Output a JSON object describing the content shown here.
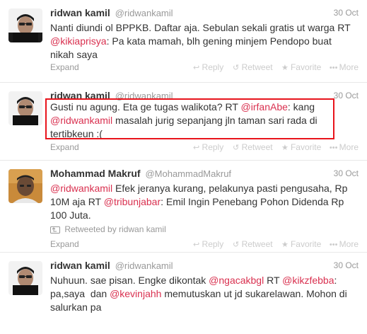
{
  "tweets": [
    {
      "fullname": "ridwan kamil",
      "username": "@ridwankamil",
      "time": "30 Oct",
      "lines": [
        [
          {
            "t": "Nanti diundi ol BPPKB. Daftar aja. Sebulan sekali gratis ut warga RT",
            "m": false
          }
        ],
        [
          {
            "t": "@kikiaprisya",
            "m": true
          },
          {
            "t": ": Pa kata mamah, blh gening minjem Pendopo buat",
            "m": false
          }
        ],
        [
          {
            "t": "nikah saya",
            "m": false
          }
        ]
      ],
      "expand": "Expand",
      "retweeted_by": ""
    },
    {
      "fullname": "ridwan kamil",
      "username": "@ridwankamil",
      "time": "30 Oct",
      "lines": [
        [
          {
            "t": "Gusti nu agung. Eta ge tugas walikota? RT ",
            "m": false
          },
          {
            "t": "@irfanAbe",
            "m": true
          },
          {
            "t": ": kang",
            "m": false
          }
        ],
        [
          {
            "t": "@ridwankamil",
            "m": true
          },
          {
            "t": " masalah jurig sepanjang jln taman sari rada di",
            "m": false
          }
        ],
        [
          {
            "t": "tertibkeun :(",
            "m": false
          }
        ]
      ],
      "expand": "Expand",
      "retweeted_by": ""
    },
    {
      "fullname": "Mohammad Makruf",
      "username": "@MohammadMakruf",
      "time": "30 Oct",
      "lines": [
        [
          {
            "t": "@ridwankamil",
            "m": true
          },
          {
            "t": " Efek jeranya kurang, pelakunya pasti pengusaha, Rp",
            "m": false
          }
        ],
        [
          {
            "t": "10M aja RT ",
            "m": false
          },
          {
            "t": "@tribunjabar",
            "m": true
          },
          {
            "t": ": Emil Ingin Penebang Pohon Didenda Rp",
            "m": false
          }
        ],
        [
          {
            "t": "100 Juta.",
            "m": false
          }
        ]
      ],
      "expand": "Expand",
      "retweeted_by": "Retweeted by ridwan kamil"
    },
    {
      "fullname": "ridwan kamil",
      "username": "@ridwankamil",
      "time": "30 Oct",
      "lines": [
        [
          {
            "t": "Nuhuun. sae pisan. Engke dikontak ",
            "m": false
          },
          {
            "t": "@ngacakbgl",
            "m": true
          },
          {
            "t": " RT ",
            "m": false
          },
          {
            "t": "@kikzfebba",
            "m": true
          },
          {
            "t": ":",
            "m": false
          }
        ],
        [
          {
            "t": "pa,saya  dan ",
            "m": false
          },
          {
            "t": "@kevinjahh",
            "m": true
          },
          {
            "t": " memutuskan ut jd sukarelawan. Mohon di",
            "m": false
          }
        ],
        [
          {
            "t": "salurkan pa",
            "m": false
          }
        ]
      ],
      "expand": "",
      "retweeted_by": ""
    }
  ],
  "actions": {
    "reply": "Reply",
    "retweet": "Retweet",
    "favorite": "Favorite",
    "more": "More"
  },
  "icons": {
    "reply": "reply-arrow-icon",
    "retweet": "retweet-arrows-icon",
    "favorite": "star-icon",
    "more": "ellipsis-icon"
  },
  "colors": {
    "mention": "#d9304f",
    "highlight_border": "#e8141c",
    "muted": "#999999"
  }
}
